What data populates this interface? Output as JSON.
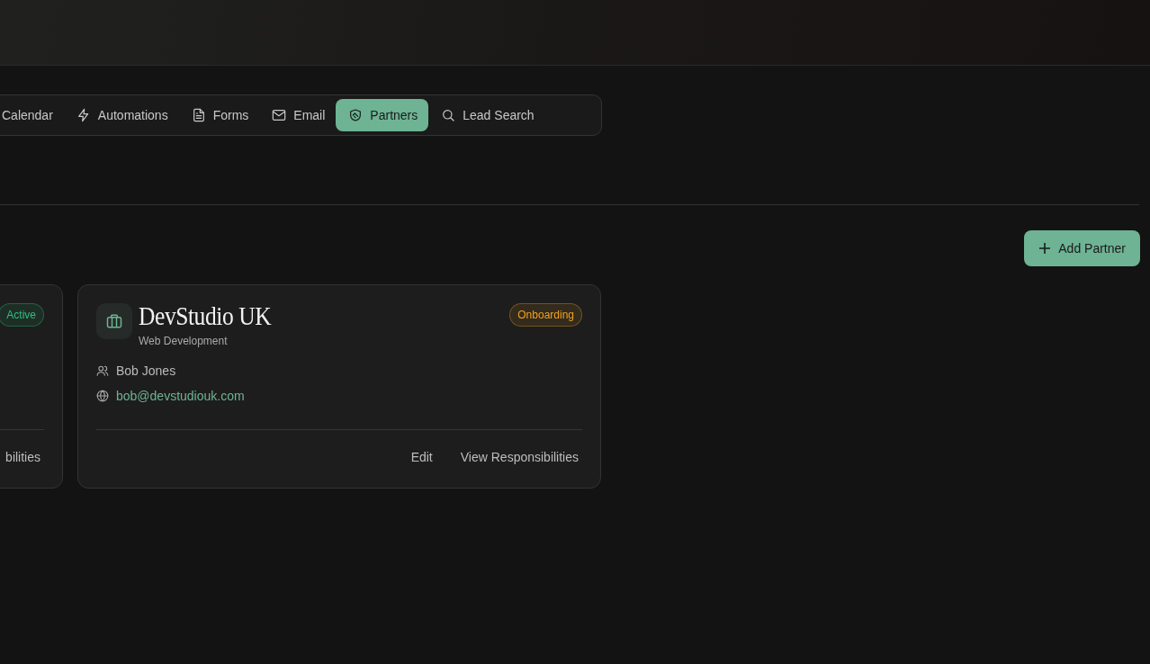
{
  "tabs": [
    {
      "label": "Calendar",
      "selected": false
    },
    {
      "label": "Automations",
      "selected": false
    },
    {
      "label": "Forms",
      "selected": false
    },
    {
      "label": "Email",
      "selected": false
    },
    {
      "label": "Partners",
      "selected": true
    },
    {
      "label": "Lead Search",
      "selected": false
    }
  ],
  "add_button": "Add Partner",
  "partners": [
    {
      "status": "Active",
      "color": "#2fbf7f",
      "actions": [
        "bilities"
      ]
    },
    {
      "name": "DevStudio UK",
      "category": "Web Development",
      "contact": "Bob Jones",
      "email": "bob@devstudiouk.com",
      "status": "Onboarding",
      "color": "#f0a020",
      "actions": [
        "Edit",
        "View Responsibilities"
      ]
    }
  ]
}
